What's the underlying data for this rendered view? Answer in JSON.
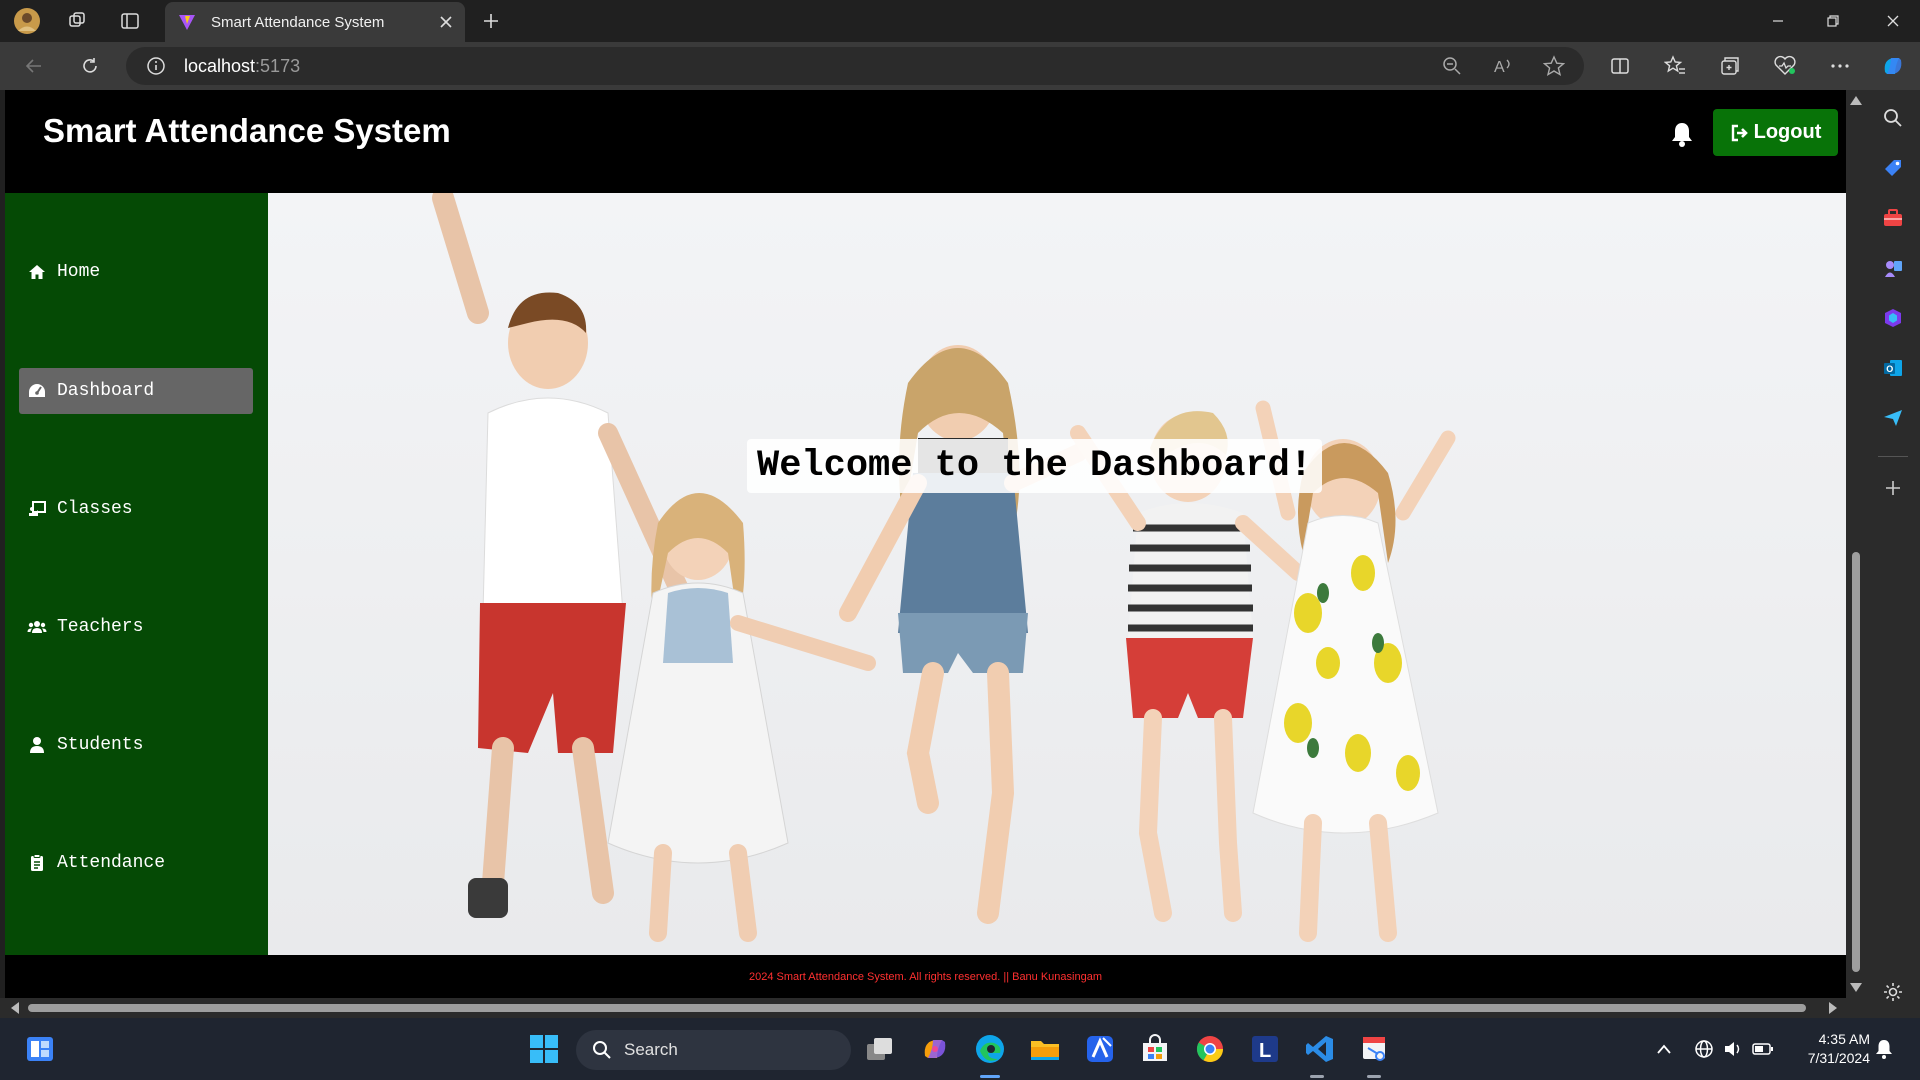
{
  "browser": {
    "tab_title": "Smart Attendance System",
    "url_host": "localhost",
    "url_port": ":5173"
  },
  "app": {
    "title": "Smart Attendance System",
    "logout_label": "Logout",
    "nav": [
      {
        "label": "Home",
        "icon": "home-icon"
      },
      {
        "label": "Dashboard",
        "icon": "dashboard-icon",
        "active": true
      },
      {
        "label": "Classes",
        "icon": "chalkboard-icon"
      },
      {
        "label": "Teachers",
        "icon": "users-icon"
      },
      {
        "label": "Students",
        "icon": "user-icon"
      },
      {
        "label": "Attendance",
        "icon": "clipboard-icon"
      }
    ],
    "welcome": "Welcome to the Dashboard!",
    "footer": "2024 Smart Attendance System. All rights reserved. || Banu Kunasingam"
  },
  "taskbar": {
    "search_label": "Search",
    "time": "4:35 AM",
    "date": "7/31/2024"
  },
  "colors": {
    "sidebar_green": "#054a05",
    "logout_green": "#087308",
    "active_nav": "#666666",
    "footer_text": "#ff3030"
  }
}
